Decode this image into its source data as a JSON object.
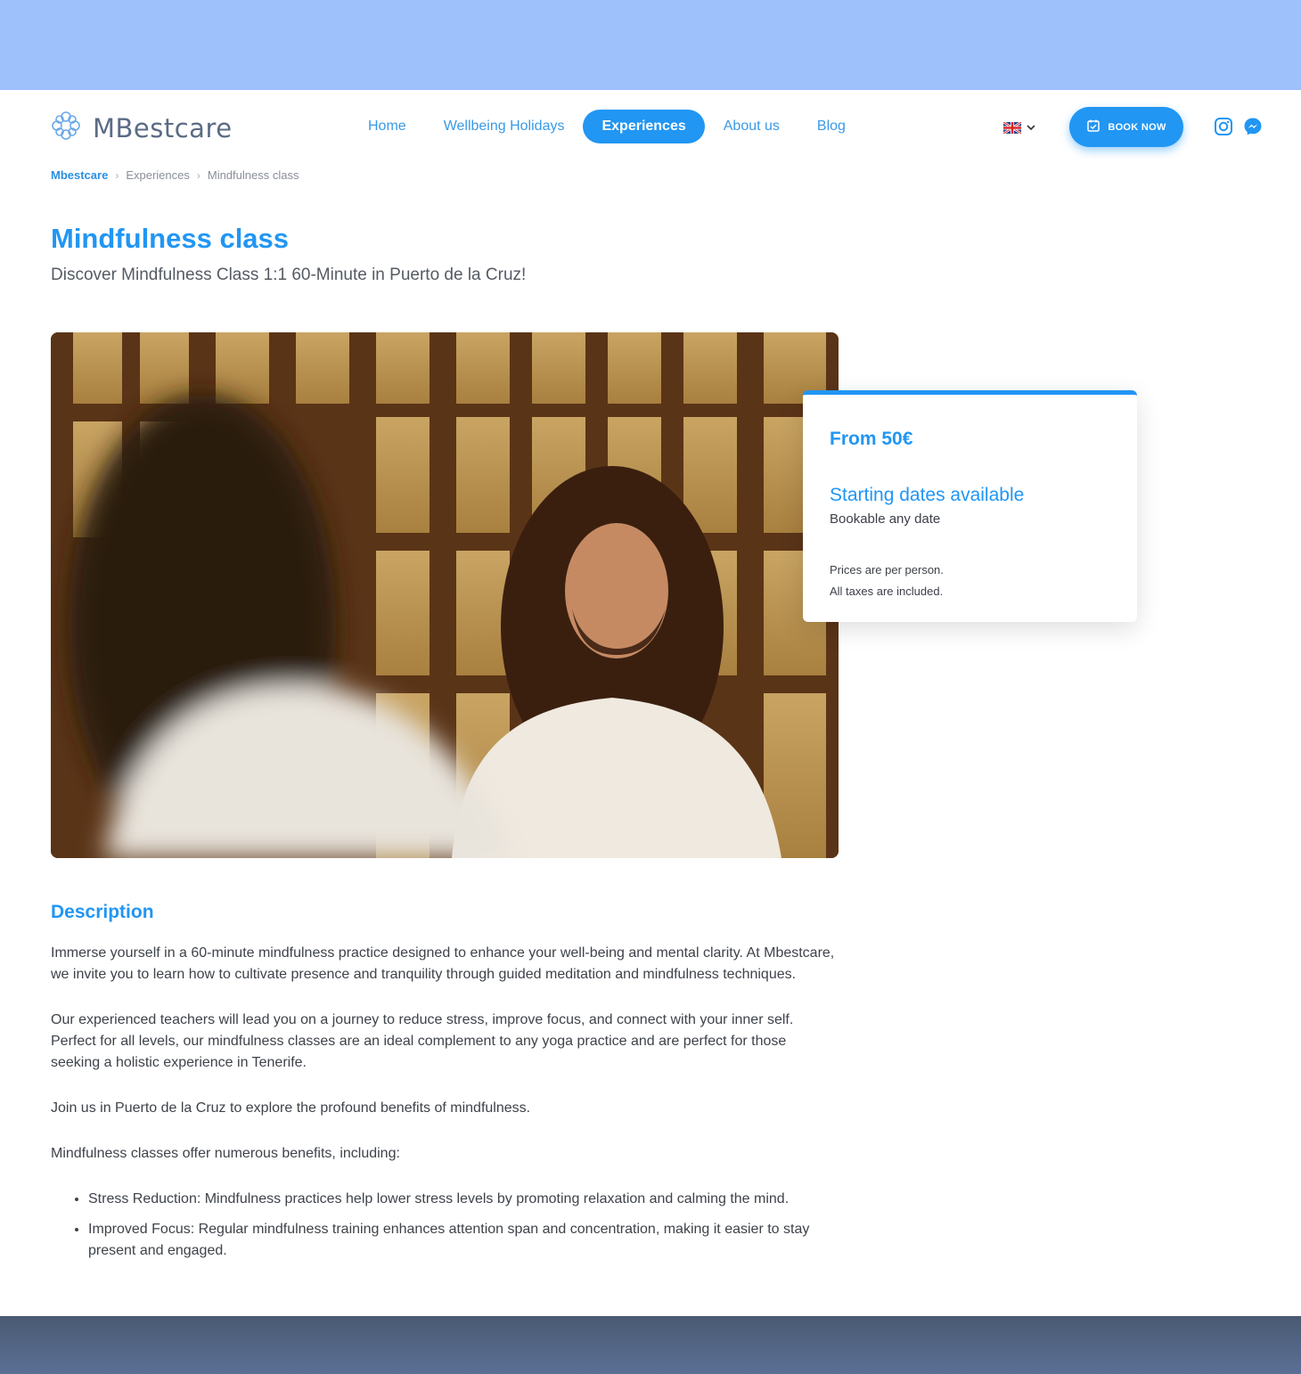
{
  "brand": {
    "name": "MBestcare"
  },
  "nav": {
    "items": [
      {
        "label": "Home",
        "active": false
      },
      {
        "label": "Wellbeing Holidays",
        "active": false
      },
      {
        "label": "Experiences",
        "active": true
      },
      {
        "label": "About us",
        "active": false
      },
      {
        "label": "Blog",
        "active": false
      }
    ]
  },
  "header": {
    "book_label": "BOOK NOW",
    "language_icon": "uk-flag-icon",
    "social_icons": [
      "instagram-icon",
      "messenger-icon"
    ]
  },
  "breadcrumb": {
    "home": "Mbestcare",
    "section": "Experiences",
    "current": "Mindfulness class"
  },
  "page": {
    "title": "Mindfulness class",
    "subtitle": "Discover Mindfulness Class 1:1 60-Minute in Puerto de la Cruz!"
  },
  "price_card": {
    "price": "From 50€",
    "dates_title": "Starting dates available",
    "dates_sub": "Bookable any date",
    "note_1": "Prices are per person.",
    "note_2": "All taxes are included."
  },
  "description": {
    "title": "Description",
    "paragraphs": [
      "Immerse yourself in a 60-minute mindfulness practice designed to enhance your well-being and mental clarity. At Mbestcare, we invite you to learn how to cultivate presence and tranquility through guided meditation and mindfulness techniques.",
      "Our experienced teachers will lead you on a journey to reduce stress, improve focus, and connect with your inner self. Perfect for all levels, our mindfulness classes are an ideal complement to any yoga practice and are perfect for those seeking a holistic experience in Tenerife.",
      "Join us in Puerto de la Cruz to explore the profound benefits of mindfulness.",
      "Mindfulness classes offer numerous benefits, including:"
    ],
    "benefits": [
      "Stress Reduction: Mindfulness practices help lower stress levels by promoting relaxation and calming the mind.",
      "Improved Focus: Regular mindfulness training enhances attention span and concentration, making it easier to stay present and engaged."
    ]
  },
  "colors": {
    "accent": "#2196f3",
    "top_band": "#9ec0fb",
    "text": "#3e434a"
  }
}
